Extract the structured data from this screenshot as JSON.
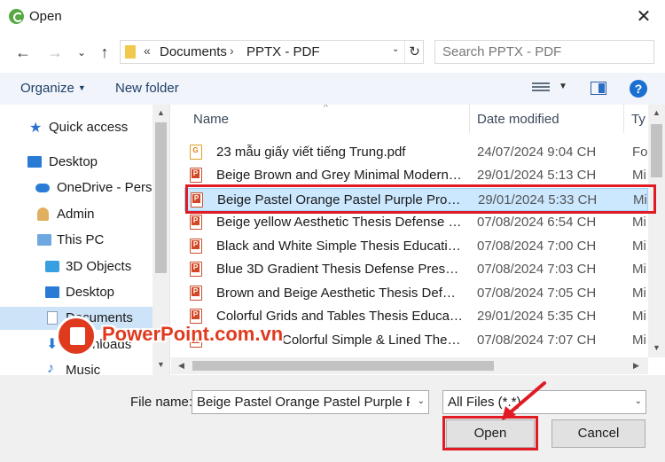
{
  "window": {
    "title": "Open",
    "close_glyph": "✕"
  },
  "nav": {
    "back": "←",
    "forward": "→",
    "recent": "⌄",
    "up": "↑",
    "refresh": "↻"
  },
  "address": {
    "overflow": "«",
    "crumbs": [
      "Documents",
      "PPTX - PDF"
    ],
    "sep": "›",
    "dropdown": "⌄"
  },
  "search": {
    "placeholder": "Search PPTX - PDF"
  },
  "toolbar": {
    "organize": "Organize",
    "new_folder": "New folder",
    "help": "?"
  },
  "sidebar": {
    "items": [
      {
        "label": "Quick access",
        "icon": "star-icon"
      },
      {
        "label": "Desktop",
        "icon": "desktop-icon"
      },
      {
        "label": "OneDrive - Perso",
        "icon": "cloud-icon"
      },
      {
        "label": "Admin",
        "icon": "user-icon"
      },
      {
        "label": "This PC",
        "icon": "computer-icon"
      },
      {
        "label": "3D Objects",
        "icon": "cube-icon"
      },
      {
        "label": "Desktop",
        "icon": "desktop-icon"
      },
      {
        "label": "Documents",
        "icon": "document-icon"
      },
      {
        "label": "Downloads",
        "icon": "download-icon"
      },
      {
        "label": "Music",
        "icon": "music-icon"
      }
    ]
  },
  "columns": {
    "name": "Name",
    "date": "Date modified",
    "type": "Ty"
  },
  "files": [
    {
      "name": "23 mẫu giấy viết tiếng Trung.pdf",
      "date": "24/07/2024 9:04 CH",
      "type": "Fo",
      "icon": "pdf-icon"
    },
    {
      "name": "Beige Brown and Grey Minimal Modern ...",
      "date": "29/01/2024 5:13 CH",
      "type": "Mi",
      "icon": "pptx-icon"
    },
    {
      "name": "Beige Pastel Orange Pastel Purple Profess...",
      "date": "29/01/2024 5:33 CH",
      "type": "Mi",
      "icon": "pptx-icon"
    },
    {
      "name": "Beige yellow Aesthetic Thesis Defense pr...",
      "date": "07/08/2024 6:54 CH",
      "type": "Mi",
      "icon": "pptx-icon"
    },
    {
      "name": "Black and White Simple Thesis Education...",
      "date": "07/08/2024 7:00 CH",
      "type": "Mi",
      "icon": "pptx-icon"
    },
    {
      "name": "Blue 3D Gradient Thesis Defense Present...",
      "date": "07/08/2024 7:03 CH",
      "type": "Mi",
      "icon": "pptx-icon"
    },
    {
      "name": "Brown and Beige Aesthetic Thesis Defens...",
      "date": "07/08/2024 7:05 CH",
      "type": "Mi",
      "icon": "pptx-icon"
    },
    {
      "name": "Colorful Grids and Tables Thesis Educatio...",
      "date": "29/01/2024 5:35 CH",
      "type": "Mi",
      "icon": "pptx-icon"
    },
    {
      "name": "Colorful Simple & Lined Thesis De...",
      "date": "07/08/2024 7:07 CH",
      "type": "Mi",
      "icon": "pptx-icon"
    }
  ],
  "bottom": {
    "file_name_label": "File name:",
    "file_name_value": "Beige Pastel Orange Pastel Purple Profess",
    "file_type": "All Files (*.*)",
    "open": "Open",
    "cancel": "Cancel"
  },
  "watermark": {
    "text": "PowerPoint.com.vn"
  },
  "colors": {
    "accent": "#1a6fd0",
    "highlight": "#e01b24",
    "selection": "#cce8ff"
  }
}
